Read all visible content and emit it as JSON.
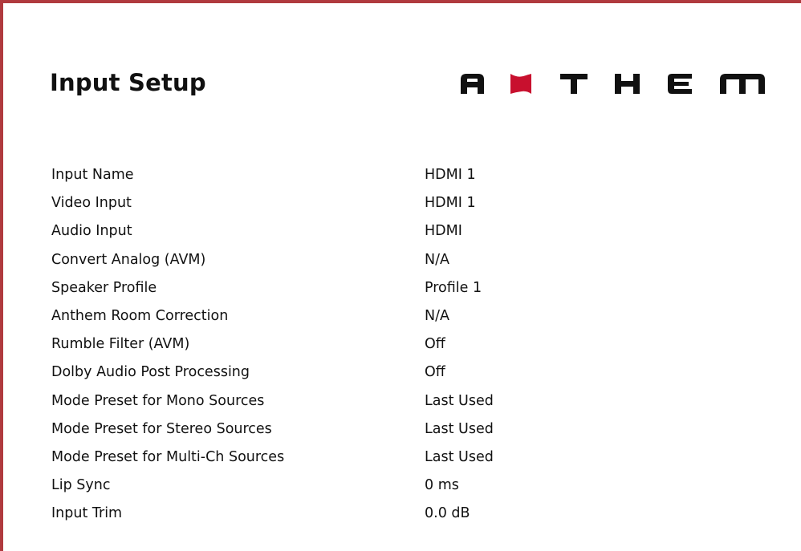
{
  "page": {
    "title": "Input Setup",
    "accent_color": "#b03a3e"
  },
  "brand": {
    "logo_text": "ANTHEM",
    "logo_icon": "red-flag-A-icon"
  },
  "settings": [
    {
      "label": "Input Name",
      "value": "HDMI 1"
    },
    {
      "label": "Video Input",
      "value": "HDMI 1"
    },
    {
      "label": "Audio Input",
      "value": "HDMI"
    },
    {
      "label": "Convert Analog (AVM)",
      "value": "N/A"
    },
    {
      "label": "Speaker Profile",
      "value": "Profile 1"
    },
    {
      "label": "Anthem Room Correction",
      "value": "N/A"
    },
    {
      "label": "Rumble Filter (AVM)",
      "value": "Off"
    },
    {
      "label": "Dolby Audio Post Processing",
      "value": "Off"
    },
    {
      "label": "Mode Preset for Mono Sources",
      "value": "Last Used"
    },
    {
      "label": "Mode Preset for Stereo Sources",
      "value": "Last Used"
    },
    {
      "label": "Mode Preset for Multi-Ch Sources",
      "value": "Last Used"
    },
    {
      "label": "Lip Sync",
      "value": "0 ms"
    },
    {
      "label": "Input Trim",
      "value": "0.0 dB"
    }
  ]
}
